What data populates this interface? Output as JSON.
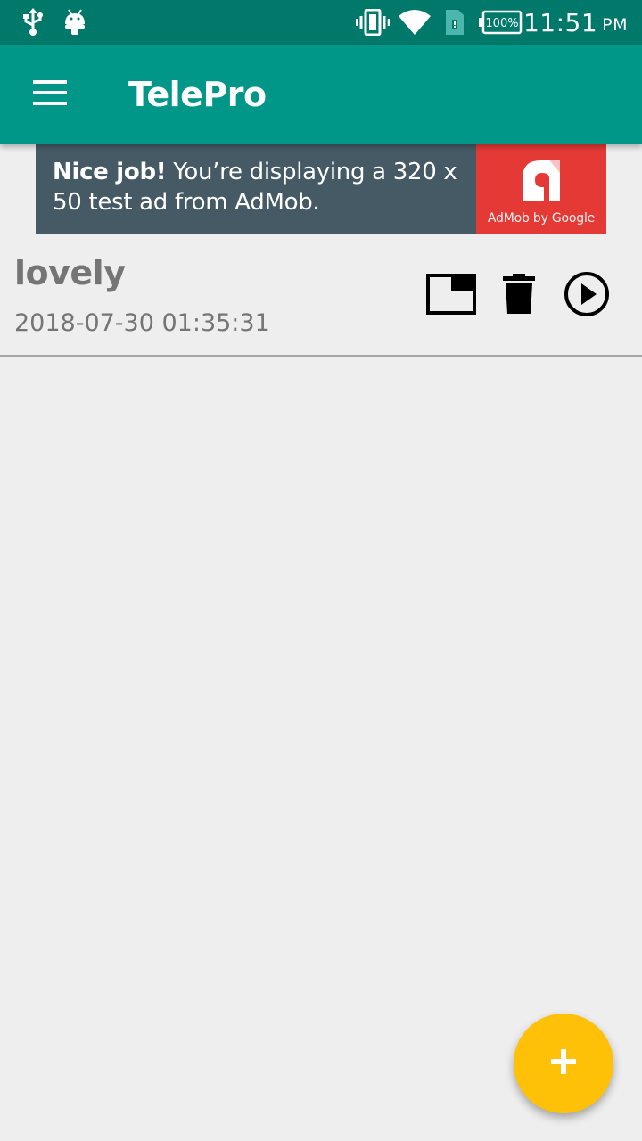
{
  "status_bar": {
    "icons": [
      "usb-icon",
      "android-debug-icon",
      "vibrate-icon",
      "wifi-icon",
      "sim-card-icon",
      "battery-icon"
    ],
    "battery": "100%",
    "time": "11:51",
    "ampm": "PM"
  },
  "app_bar": {
    "title": "TelePro",
    "menu_icon": "hamburger-menu-icon"
  },
  "ad": {
    "headline": "Nice job!",
    "body": "You’re displaying a 320 x 50 test ad from AdMob.",
    "byline": "AdMob by Google"
  },
  "items": [
    {
      "title": "lovely",
      "date": "2018-07-30 01:35:31",
      "actions": [
        "picture-in-picture-icon",
        "delete-icon",
        "play-circle-icon"
      ]
    }
  ],
  "fab": {
    "icon": "add-icon"
  },
  "colors": {
    "status_bar": "#00796b",
    "app_bar": "#009688",
    "background": "#eeeeee",
    "ad_background": "#465a65",
    "ad_logo": "#e53935",
    "fab": "#ffc107",
    "item_text": "#757575"
  }
}
